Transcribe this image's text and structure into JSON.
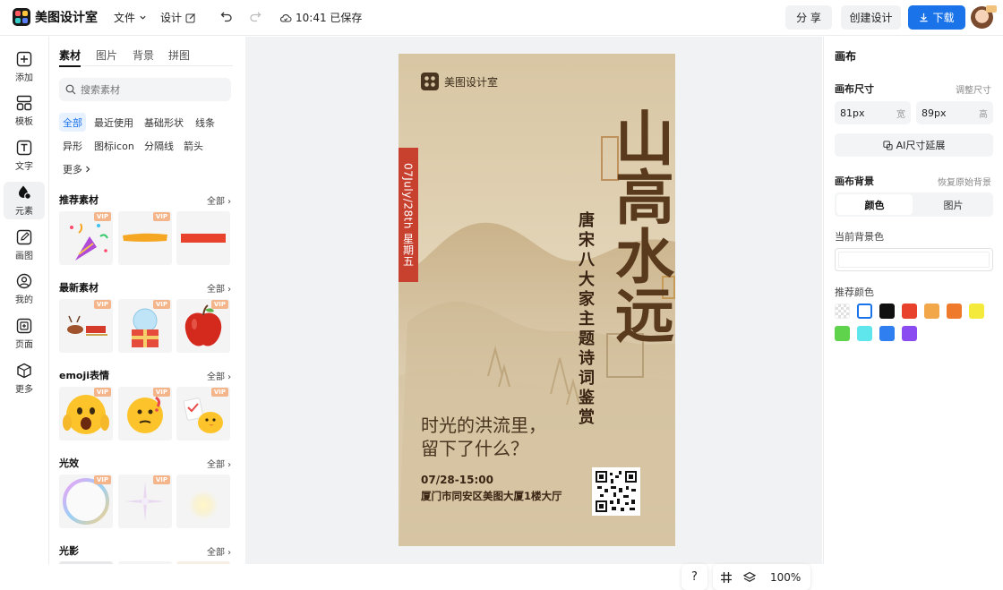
{
  "app": {
    "name": "美图设计室",
    "save_status": "10:41 已保存"
  },
  "toolbar": {
    "file": "文件",
    "design": "设计",
    "share": "分 享",
    "create": "创建设计",
    "download": "下载"
  },
  "leftnav": [
    {
      "label": "添加",
      "icon": "plus-square-icon"
    },
    {
      "label": "模板",
      "icon": "template-icon"
    },
    {
      "label": "文字",
      "icon": "text-icon"
    },
    {
      "label": "元素",
      "icon": "shapes-icon"
    },
    {
      "label": "画图",
      "icon": "pen-icon"
    },
    {
      "label": "我的",
      "icon": "user-icon"
    },
    {
      "label": "页面",
      "icon": "add-page-icon"
    },
    {
      "label": "更多",
      "icon": "cube-icon"
    }
  ],
  "panel": {
    "tabs": [
      "素材",
      "图片",
      "背景",
      "拼图"
    ],
    "search_placeholder": "搜索素材",
    "chips": [
      "全部",
      "最近使用",
      "基础形状",
      "线条",
      "异形",
      "图标icon",
      "分隔线",
      "箭头",
      "更多"
    ],
    "all_label": "全部",
    "vip_label": "VIP",
    "sections": [
      {
        "title": "推荐素材"
      },
      {
        "title": "最新素材"
      },
      {
        "title": "emoji表情"
      },
      {
        "title": "光效"
      },
      {
        "title": "光影"
      }
    ]
  },
  "poster": {
    "brand": "美图设计室",
    "date_banner": "07July/28th 星期五",
    "title": "山高水远",
    "subtitle": "唐宋八大家主题诗词鉴赏",
    "quote_line1": "时光的洪流里，",
    "quote_line2": "留下了什么？",
    "time": "07/28-15:00",
    "address": "厦门市同安区美图大厦1楼大厅"
  },
  "zoom": {
    "help": "?",
    "level": "100%"
  },
  "rightpanel": {
    "title": "画布",
    "size_label": "画布尺寸",
    "adjust_size": "调整尺寸",
    "width_value": "81px",
    "width_unit": "宽",
    "height_value": "89px",
    "height_unit": "高",
    "ai_extend": "AI尺寸延展",
    "bg_label": "画布背景",
    "restore_bg": "恢复原始背景",
    "seg_color": "颜色",
    "seg_image": "图片",
    "current_bg": "当前背景色",
    "recommend": "推荐颜色",
    "colors": [
      "transparent",
      "#ffffff",
      "#111111",
      "#e8412c",
      "#f2a84a",
      "#f07a2c",
      "#f4ea3c",
      "#5fd34b",
      "#5ee6ec",
      "#2f7ff0",
      "#8a4cf0"
    ]
  }
}
